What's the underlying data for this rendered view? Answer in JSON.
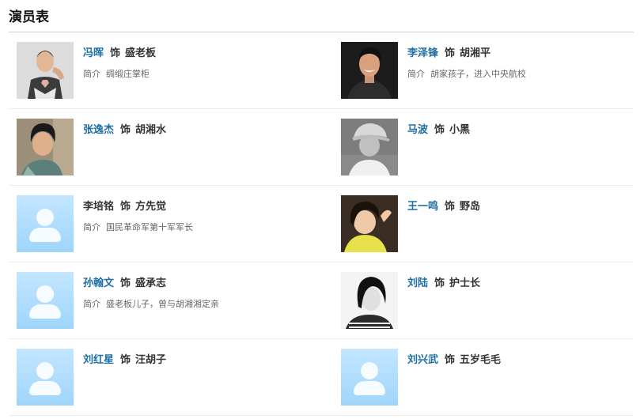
{
  "title": "演员表",
  "as_label": "饰",
  "intro_label": "简介",
  "rows": [
    {
      "left": {
        "actor": "冯晖",
        "role": "盛老板",
        "intro": "绸缎庄掌柜",
        "photo": "photo-fenghui"
      },
      "right": {
        "actor": "李泽锋",
        "role": "胡湘平",
        "intro": "胡家孩子，进入中央航校",
        "photo": "photo-lizefeng"
      }
    },
    {
      "left": {
        "actor": "张逸杰",
        "role": "胡湘水",
        "intro": "",
        "photo": "photo-zhangyijie"
      },
      "right": {
        "actor": "马波",
        "role": "小黑",
        "intro": "",
        "photo": "photo-mabo"
      }
    },
    {
      "left": {
        "actor": "李培铭",
        "role": "方先觉",
        "intro": "国民革命军第十军军长",
        "photo": "placeholder"
      },
      "right": {
        "actor": "王一鸣",
        "role": "野岛",
        "intro": "",
        "photo": "photo-wangyiming"
      }
    },
    {
      "left": {
        "actor": "孙翰文",
        "role": "盛承志",
        "intro": "盛老板儿子，曾与胡湘湘定亲",
        "photo": "placeholder"
      },
      "right": {
        "actor": "刘陆",
        "role": "护士长",
        "intro": "",
        "photo": "photo-liulu"
      }
    },
    {
      "left": {
        "actor": "刘红星",
        "role": "汪胡子",
        "intro": "",
        "photo": "placeholder"
      },
      "right": {
        "actor": "刘兴武",
        "role": "五岁毛毛",
        "intro": "",
        "photo": "placeholder"
      }
    }
  ],
  "colors": {
    "link": "#1e6ea3",
    "text": "#333333",
    "placeholder": "#a9dafd"
  }
}
